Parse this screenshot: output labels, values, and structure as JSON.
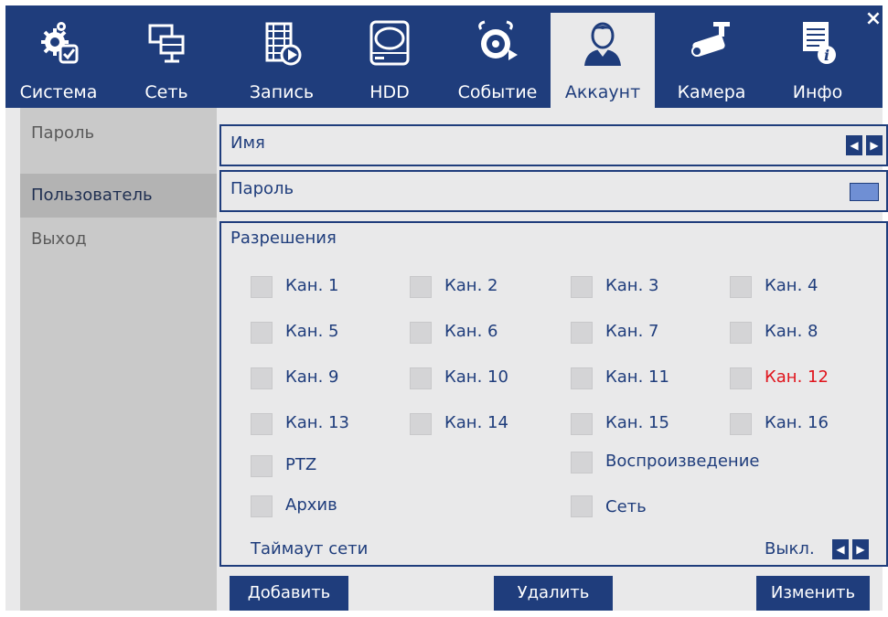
{
  "tabs": [
    {
      "label": "Система",
      "icon": "system-settings-icon"
    },
    {
      "label": "Сеть",
      "icon": "network-icon"
    },
    {
      "label": "Запись",
      "icon": "record-icon"
    },
    {
      "label": "HDD",
      "icon": "hdd-icon"
    },
    {
      "label": "Событие",
      "icon": "event-alarm-icon"
    },
    {
      "label": "Аккаунт",
      "icon": "account-user-icon",
      "active": true
    },
    {
      "label": "Камера",
      "icon": "camera-icon"
    },
    {
      "label": "Инфо",
      "icon": "info-icon"
    }
  ],
  "close_glyph": "×",
  "sidebar": {
    "items": [
      {
        "label": "Пароль"
      },
      {
        "label": "Пользователь",
        "active": true
      },
      {
        "label": "Выход"
      }
    ]
  },
  "form": {
    "name_label": "Имя",
    "password_label": "Пароль",
    "permissions_title": "Разрешения",
    "channels": [
      "Кан. 1",
      "Кан. 2",
      "Кан. 3",
      "Кан. 4",
      "Кан. 5",
      "Кан. 6",
      "Кан. 7",
      "Кан. 8",
      "Кан. 9",
      "Кан. 10",
      "Кан. 11",
      "Кан. 12",
      "Кан. 13",
      "Кан. 14",
      "Кан. 15",
      "Кан. 16"
    ],
    "highlighted_channel": "Кан. 12",
    "extra": {
      "ptz": "PTZ",
      "playback": "Воспроизведение",
      "archive": "Архив",
      "network": "Сеть"
    },
    "timeout_label": "Таймаут сети",
    "timeout_value": "Выкл."
  },
  "buttons": {
    "add": "Добавить",
    "delete": "Удалить",
    "edit": "Изменить"
  },
  "colors": {
    "brand": "#1f3d7c",
    "panel": "#e9e9ea",
    "sidebar": "#c9c9c9",
    "highlight": "#e0141c"
  }
}
